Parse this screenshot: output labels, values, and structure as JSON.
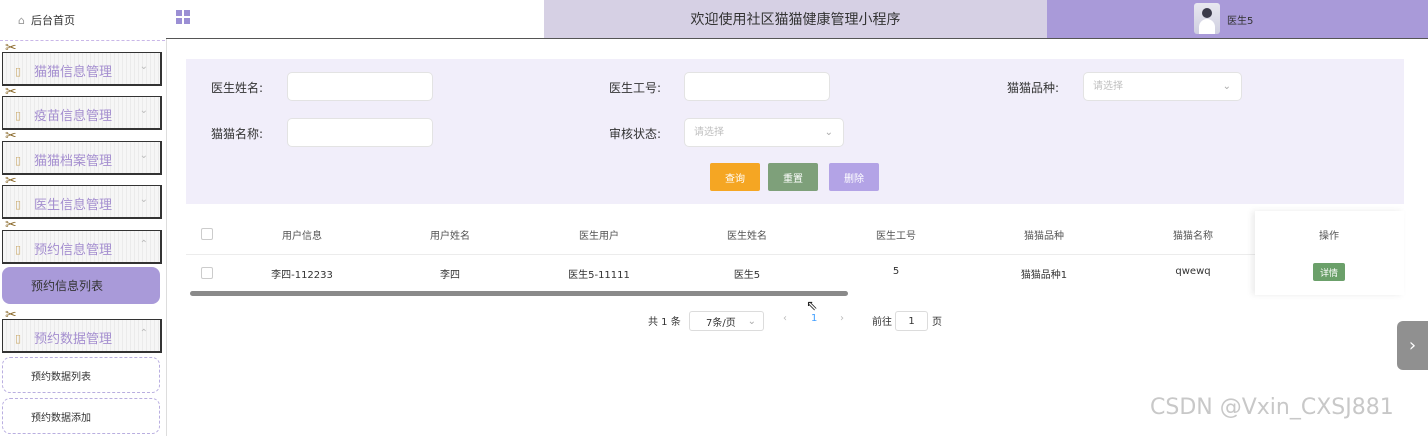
{
  "header": {
    "title": "欢迎使用社区猫猫健康管理小程序",
    "user_name": "医生5"
  },
  "sidebar": {
    "home": "后台首页",
    "menus": [
      {
        "label": "猫猫信息管理"
      },
      {
        "label": "疫苗信息管理"
      },
      {
        "label": "猫猫档案管理"
      },
      {
        "label": "医生信息管理"
      },
      {
        "label": "预约信息管理"
      }
    ],
    "active_sub": "预约信息列表",
    "menu2": "预约数据管理",
    "subs": [
      "预约数据列表",
      "预约数据添加"
    ]
  },
  "search": {
    "doctor_name_label": "医生姓名:",
    "doctor_no_label": "医生工号:",
    "breed_label": "猫猫品种:",
    "breed_placeholder": "请选择",
    "cat_name_label": "猫猫名称:",
    "status_label": "审核状态:",
    "status_placeholder": "请选择",
    "query_btn": "查询",
    "reset_btn": "重置",
    "delete_btn": "删除"
  },
  "colors": {
    "accent": "#a99ad9",
    "query": "#f5a623",
    "reset": "#7ea07a",
    "delete": "#b3a3e6",
    "detail": "#6ba06a"
  },
  "table": {
    "headers": [
      "用户信息",
      "用户姓名",
      "医生用户",
      "医生姓名",
      "医生工号",
      "猫猫品种",
      "猫猫名称",
      "操作"
    ],
    "rows": [
      {
        "cells": [
          "李四-112233",
          "李四",
          "医生5-11111",
          "医生5",
          "5",
          "猫猫品种1",
          "qwewq"
        ],
        "action": "详情"
      }
    ]
  },
  "pagination": {
    "total": "共 1 条",
    "page_size": "7条/页",
    "current": "1",
    "goto_label": "前往",
    "goto_value": "1",
    "page_suffix": "页"
  },
  "watermark": "CSDN @Vxin_CXSJ881"
}
